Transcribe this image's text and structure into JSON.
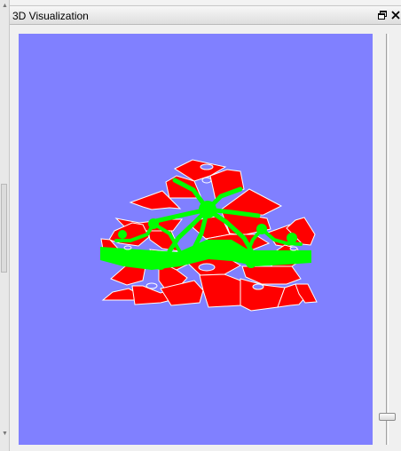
{
  "panel": {
    "title": "3D Visualization",
    "float_icon": "restore-window-icon",
    "close_icon": "close-icon"
  },
  "viewport": {
    "background_color": "#8080ff",
    "region_color": "#ff0000",
    "network_color": "#00ff00",
    "edge_color": "#ffffff"
  },
  "zoom_slider": {
    "level": 0.06
  }
}
